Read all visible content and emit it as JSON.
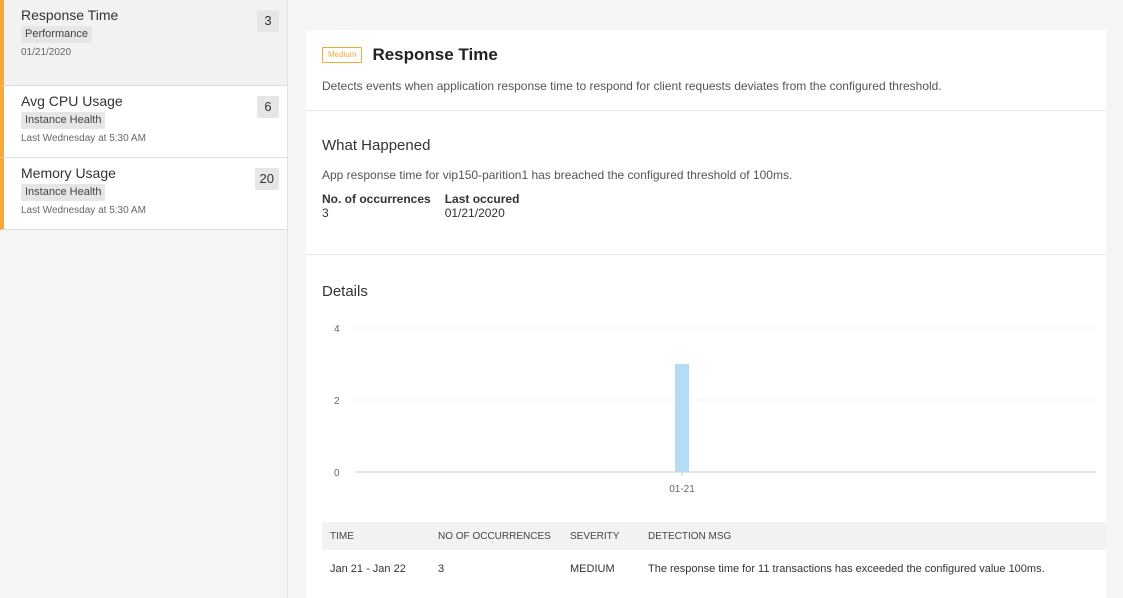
{
  "sidebar": {
    "items": [
      {
        "title": "Response Time",
        "tag": "Performance",
        "date": "01/21/2020",
        "count": "3"
      },
      {
        "title": "Avg CPU Usage",
        "tag": "Instance Health",
        "date": "Last Wednesday at 5:30 AM",
        "count": "6"
      },
      {
        "title": "Memory Usage",
        "tag": "Instance Health",
        "date": "Last Wednesday at 5:30 AM",
        "count": "20"
      }
    ]
  },
  "header": {
    "badge": "Medium",
    "title": "Response Time",
    "description": "Detects events when application response time to respond for client requests deviates from the configured threshold."
  },
  "what_happened": {
    "title": "What Happened",
    "text": "App response time for vip150-parition1 has breached the configured threshold of 100ms.",
    "occurrences_label": "No. of occurrences",
    "occurrences_value": "3",
    "last_label": "Last occured",
    "last_value": "01/21/2020"
  },
  "details": {
    "title": "Details"
  },
  "chart_data": {
    "type": "bar",
    "categories": [
      "01-21"
    ],
    "values": [
      3
    ],
    "ylim": [
      0,
      4
    ],
    "yticks": [
      "0",
      "2",
      "4"
    ],
    "bar_color": "#b3dcf7",
    "grid": true
  },
  "table": {
    "headers": [
      "TIME",
      "NO OF OCCURRENCES",
      "SEVERITY",
      "DETECTION MSG"
    ],
    "rows": [
      [
        "Jan 21 - Jan 22",
        "3",
        "MEDIUM",
        "The response time for 11 transactions has exceeded the configured value 100ms."
      ]
    ]
  },
  "colors": {
    "accent": "#f5a93a",
    "bar": "#b3dcf7"
  }
}
